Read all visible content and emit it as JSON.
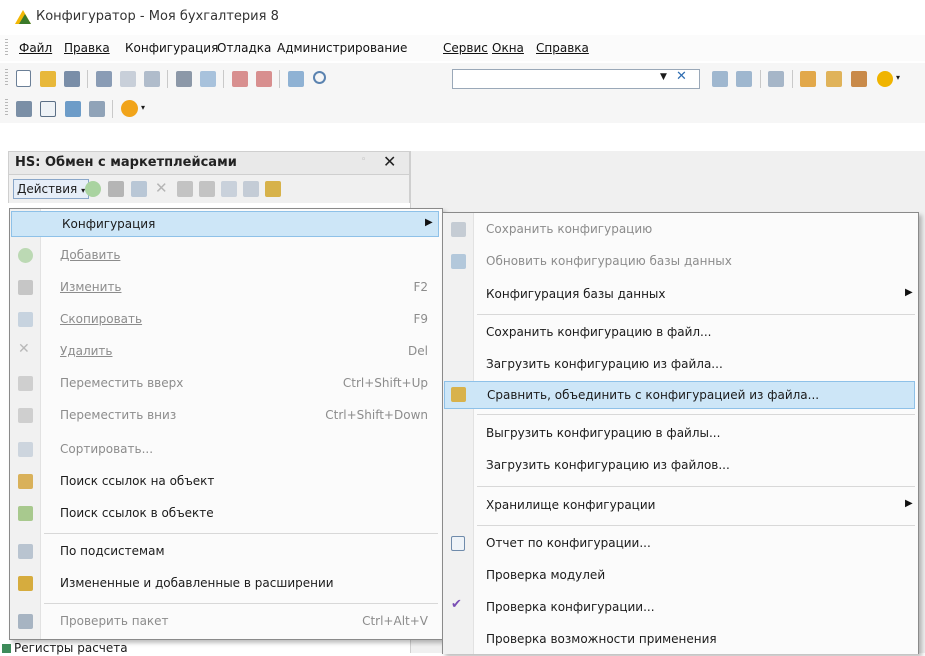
{
  "window": {
    "title": "Конфигуратор - Моя бухгалтерия 8"
  },
  "menubar": {
    "items": [
      "Файл",
      "Правка",
      "Конфигурация",
      "Отладка",
      "Администрирование",
      "Сервис",
      "Окна",
      "Справка"
    ]
  },
  "panel": {
    "title": "HS: Обмен с маркетплейсами",
    "actions_label": "Действия",
    "close_glyph": "✕"
  },
  "tree": {
    "visible_row": "Регистры расчета"
  },
  "context_menu": {
    "items": [
      {
        "label": "Конфигурация",
        "shortcut": ""
      },
      {
        "label": "Добавить",
        "shortcut": ""
      },
      {
        "label": "Изменить",
        "shortcut": "F2"
      },
      {
        "label": "Скопировать",
        "shortcut": "F9"
      },
      {
        "label": "Удалить",
        "shortcut": "Del"
      },
      {
        "label": "Переместить вверх",
        "shortcut": "Ctrl+Shift+Up"
      },
      {
        "label": "Переместить вниз",
        "shortcut": "Ctrl+Shift+Down"
      },
      {
        "label": "Сортировать...",
        "shortcut": ""
      },
      {
        "label": "Поиск ссылок на объект",
        "shortcut": ""
      },
      {
        "label": "Поиск ссылок в объекте",
        "shortcut": ""
      },
      {
        "label": "По подсистемам",
        "shortcut": ""
      },
      {
        "label": "Измененные и добавленные в расширении",
        "shortcut": ""
      },
      {
        "label": "Проверить пакет",
        "shortcut": "Ctrl+Alt+V"
      }
    ]
  },
  "submenu": {
    "items": [
      "Сохранить конфигурацию",
      "Обновить конфигурацию базы данных",
      "Конфигурация базы данных",
      "Сохранить конфигурацию в файл...",
      "Загрузить конфигурацию из файла...",
      "Сравнить, объединить с конфигурацией из файла...",
      "Выгрузить конфигурацию в файлы...",
      "Загрузить конфигурацию из файлов...",
      "Хранилище конфигурации",
      "Отчет по конфигурации...",
      "Проверка модулей",
      "Проверка конфигурации...",
      "Проверка возможности применения"
    ]
  },
  "colors": {
    "highlight": "#cde6f7",
    "highlight_border": "#8ec1e8",
    "disabled_text": "#8c8c8c"
  }
}
